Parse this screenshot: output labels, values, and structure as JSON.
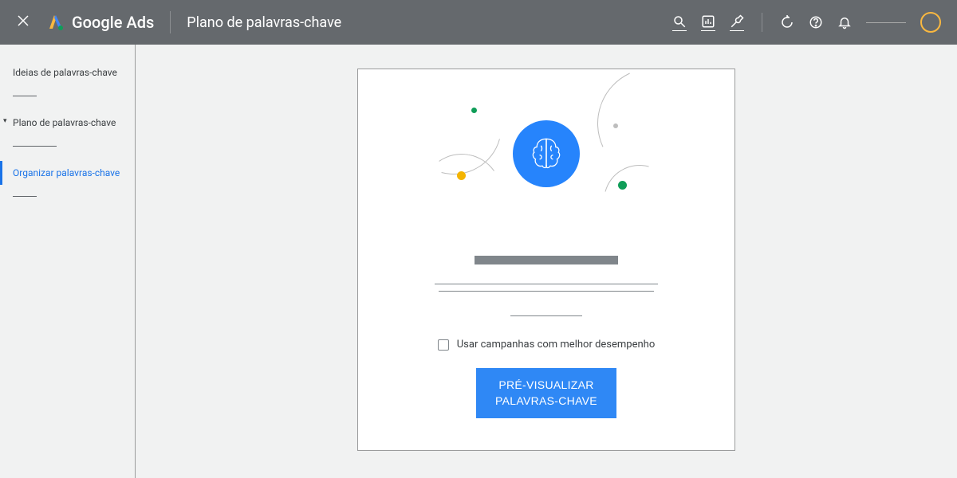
{
  "header": {
    "brand": "Google Ads",
    "page_title": "Plano de palavras-chave"
  },
  "sidebar": {
    "items": [
      {
        "label": "Ideias de palavras-chave"
      },
      {
        "label": "Plano de palavras-chave"
      },
      {
        "label": "Organizar palavras-chave"
      }
    ]
  },
  "card": {
    "checkbox_label": "Usar campanhas com melhor desempenho",
    "preview_button_line1": "PRÉ-VISUALIZAR",
    "preview_button_line2": "PALAVRAS-CHAVE"
  }
}
